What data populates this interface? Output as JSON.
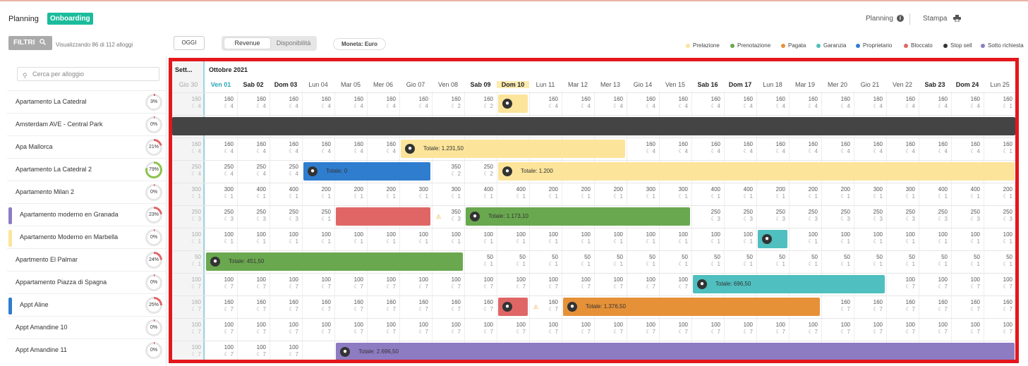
{
  "header": {
    "title": "Planning",
    "badge": "Onboarding",
    "planning_link": "Planning",
    "print_link": "Stampa"
  },
  "toolbar": {
    "filter_label": "FILTRI",
    "filter_summary": "Visualizzando 86 di 112 alloggi",
    "today_button": "OGGI",
    "view_revenue": "Revenue",
    "view_availability": "Disponibilità",
    "currency": "Moneta: Euro"
  },
  "legend": [
    {
      "label": "Prelazione",
      "color": "#fce49a"
    },
    {
      "label": "Prenotazione",
      "color": "#6aa84f"
    },
    {
      "label": "Pagata",
      "color": "#e69138"
    },
    {
      "label": "Garanzia",
      "color": "#4fbfbf"
    },
    {
      "label": "Proprietario",
      "color": "#2f7dcf"
    },
    {
      "label": "Bloccato",
      "color": "#e06666"
    },
    {
      "label": "Stop sell",
      "color": "#333333"
    },
    {
      "label": "Sotto richiesta",
      "color": "#8e7cc3"
    }
  ],
  "search": {
    "placeholder": "Cerca per alloggio"
  },
  "properties": [
    {
      "name": "Apartamento La Catedral",
      "pct": "3%",
      "ring": "#e06666",
      "val": 3,
      "tag": ""
    },
    {
      "name": "Amsterdam AVE - Central Park",
      "pct": "0%",
      "ring": "#e06666",
      "val": 0,
      "tag": ""
    },
    {
      "name": "Apa Mallorca",
      "pct": "21%",
      "ring": "#e06666",
      "val": 21,
      "tag": ""
    },
    {
      "name": "Apartamento La Catedral 2",
      "pct": "79%",
      "ring": "#8bc34a",
      "val": 79,
      "tag": ""
    },
    {
      "name": "Apartamento Milan 2",
      "pct": "0%",
      "ring": "#e06666",
      "val": 0,
      "tag": ""
    },
    {
      "name": "Apartamento moderno en Granada",
      "pct": "23%",
      "ring": "#e06666",
      "val": 23,
      "tag": "#8e7cc3"
    },
    {
      "name": "Apartamento Moderno en Marbella",
      "pct": "0%",
      "ring": "#e06666",
      "val": 0,
      "tag": "#fce49a"
    },
    {
      "name": "Apartmento El Palmar",
      "pct": "24%",
      "ring": "#e06666",
      "val": 24,
      "tag": ""
    },
    {
      "name": "Appartamento Piazza di Spagna",
      "pct": "0%",
      "ring": "#e06666",
      "val": 0,
      "tag": ""
    },
    {
      "name": "Appt Aline",
      "pct": "25%",
      "ring": "#e06666",
      "val": 25,
      "tag": "#2f7dcf"
    },
    {
      "name": "Appt Amandine 10",
      "pct": "0%",
      "ring": "#e06666",
      "val": 0,
      "tag": ""
    },
    {
      "name": "Appt Amandine 11",
      "pct": "0%",
      "ring": "#e06666",
      "val": 0,
      "tag": ""
    }
  ],
  "calendar": {
    "prev_month": "Sett...",
    "month": "Ottobre 2021",
    "days": [
      "Gio 30",
      "Ven 01",
      "Sab 02",
      "Dom 03",
      "Lun 04",
      "Mar 05",
      "Mer 06",
      "Gio 07",
      "Ven 08",
      "Sab 09",
      "Dom 10",
      "Lun 11",
      "Mar 12",
      "Mer 13",
      "Gio 14",
      "Ven 15",
      "Sab 16",
      "Dom 17",
      "Lun 18",
      "Mar 19",
      "Mer 20",
      "Gio 21",
      "Ven 22",
      "Sab 23",
      "Dom 24",
      "Lun 25"
    ],
    "weekend": [
      false,
      false,
      true,
      true,
      false,
      false,
      false,
      false,
      false,
      true,
      true,
      false,
      false,
      false,
      false,
      false,
      true,
      true,
      false,
      false,
      false,
      false,
      false,
      true,
      true,
      false
    ],
    "rows": [
      {
        "prices": [
          160,
          160,
          160,
          160,
          160,
          160,
          160,
          160,
          160,
          160,
          "",
          160,
          160,
          160,
          160,
          160,
          160,
          160,
          160,
          160,
          160,
          160,
          160,
          160,
          160,
          160
        ],
        "mins": [
          4,
          4,
          4,
          4,
          4,
          4,
          4,
          4,
          2,
          2,
          "",
          4,
          4,
          4,
          4,
          4,
          4,
          4,
          4,
          4,
          4,
          4,
          4,
          4,
          4,
          1
        ]
      },
      {
        "prices": [],
        "mins": []
      },
      {
        "prices": [
          160,
          160,
          160,
          160,
          160,
          160,
          160,
          "",
          "",
          "",
          "",
          "",
          "",
          "",
          160,
          160,
          160,
          160,
          160,
          160,
          160,
          160,
          160,
          160,
          160,
          160
        ],
        "mins": [
          4,
          4,
          4,
          4,
          4,
          4,
          4,
          "",
          "",
          "",
          "",
          "",
          "",
          "",
          4,
          4,
          4,
          4,
          4,
          4,
          4,
          4,
          4,
          4,
          4,
          1
        ]
      },
      {
        "prices": [
          250,
          250,
          250,
          250,
          "",
          "",
          "",
          "",
          350,
          250,
          "",
          "",
          "",
          "",
          "",
          "",
          "",
          "",
          "",
          "",
          "",
          "",
          "",
          "",
          "",
          ""
        ],
        "mins": [
          4,
          4,
          4,
          4,
          "",
          "",
          "",
          "",
          2,
          2,
          "",
          "",
          "",
          "",
          "",
          "",
          "",
          "",
          "",
          "",
          "",
          "",
          "",
          "",
          "",
          ""
        ]
      },
      {
        "prices": [
          300,
          300,
          400,
          400,
          200,
          200,
          200,
          300,
          300,
          400,
          400,
          200,
          200,
          200,
          300,
          300,
          400,
          400,
          200,
          200,
          200,
          300,
          300,
          400,
          400,
          200
        ],
        "mins": [
          1,
          1,
          1,
          1,
          1,
          1,
          1,
          1,
          1,
          1,
          1,
          1,
          1,
          1,
          1,
          1,
          1,
          1,
          1,
          1,
          1,
          1,
          1,
          1,
          1,
          1
        ]
      },
      {
        "prices": [
          250,
          250,
          250,
          250,
          250,
          "",
          "",
          "",
          350,
          "",
          "",
          "",
          "",
          "",
          "",
          "",
          250,
          250,
          250,
          250,
          250,
          250,
          250,
          250,
          250,
          250
        ],
        "mins": [
          3,
          3,
          3,
          3,
          1,
          "",
          "",
          "",
          3,
          "",
          "",
          "",
          "",
          "",
          "",
          "",
          3,
          3,
          3,
          3,
          3,
          3,
          3,
          3,
          3,
          3
        ]
      },
      {
        "prices": [
          100,
          100,
          100,
          100,
          100,
          100,
          100,
          100,
          100,
          100,
          100,
          100,
          100,
          100,
          100,
          100,
          100,
          100,
          "",
          100,
          100,
          100,
          100,
          100,
          100,
          100
        ],
        "mins": [
          1,
          1,
          1,
          1,
          1,
          1,
          1,
          1,
          1,
          1,
          1,
          1,
          1,
          1,
          1,
          1,
          1,
          1,
          "",
          1,
          1,
          1,
          1,
          1,
          1,
          1
        ]
      },
      {
        "prices": [
          50,
          "",
          "",
          "",
          "",
          "",
          "",
          "",
          "",
          50,
          50,
          50,
          50,
          50,
          50,
          50,
          50,
          50,
          50,
          50,
          50,
          50,
          50,
          50,
          50,
          50
        ],
        "mins": [
          1,
          "",
          "",
          "",
          "",
          "",
          "",
          "",
          "",
          1,
          1,
          1,
          1,
          1,
          1,
          1,
          1,
          1,
          1,
          1,
          1,
          1,
          1,
          1,
          1,
          1
        ]
      },
      {
        "prices": [
          100,
          100,
          100,
          100,
          100,
          100,
          100,
          100,
          100,
          100,
          100,
          100,
          100,
          100,
          100,
          100,
          "",
          "",
          "",
          "",
          "",
          "",
          100,
          100,
          100,
          100
        ],
        "mins": [
          7,
          7,
          7,
          7,
          7,
          7,
          7,
          7,
          7,
          7,
          7,
          7,
          7,
          7,
          7,
          7,
          "",
          "",
          "",
          "",
          "",
          "",
          7,
          7,
          7,
          7
        ]
      },
      {
        "prices": [
          160,
          160,
          160,
          160,
          160,
          160,
          160,
          160,
          160,
          160,
          "",
          160,
          "",
          "",
          "",
          "",
          "",
          "",
          "",
          "",
          160,
          160,
          160,
          160,
          160,
          160
        ],
        "mins": [
          7,
          7,
          7,
          7,
          7,
          7,
          7,
          7,
          7,
          7,
          "",
          7,
          "",
          "",
          "",
          "",
          "",
          "",
          "",
          "",
          7,
          7,
          7,
          7,
          7,
          7
        ]
      },
      {
        "prices": [
          100,
          100,
          100,
          100,
          100,
          100,
          100,
          100,
          100,
          100,
          100,
          100,
          100,
          100,
          100,
          100,
          100,
          100,
          100,
          100,
          100,
          100,
          100,
          100,
          100,
          100
        ],
        "mins": [
          7,
          7,
          7,
          7,
          7,
          7,
          7,
          7,
          7,
          7,
          7,
          7,
          7,
          7,
          7,
          7,
          7,
          7,
          7,
          7,
          7,
          7,
          7,
          7,
          7,
          7
        ]
      },
      {
        "prices": [
          100,
          100,
          100,
          100,
          "",
          "",
          "",
          "",
          "",
          "",
          "",
          "",
          "",
          "",
          "",
          "",
          "",
          "",
          "",
          "",
          "",
          "",
          "",
          "",
          "",
          ""
        ],
        "mins": [
          7,
          7,
          7,
          7,
          "",
          "",
          "",
          "",
          "",
          "",
          "",
          "",
          "",
          "",
          "",
          "",
          "",
          "",
          "",
          "",
          "",
          "",
          "",
          "",
          "",
          ""
        ]
      }
    ],
    "bands": [
      {
        "row": 0,
        "start": 10,
        "span": 1,
        "color": "#fce49a",
        "label": ""
      },
      {
        "row": 1,
        "start": 0,
        "span": 26,
        "color": "#444444",
        "label": ""
      },
      {
        "row": 2,
        "start": 7,
        "span": 7,
        "color": "#fce49a",
        "label": "Totale: 1.231,50"
      },
      {
        "row": 3,
        "start": 4,
        "span": 4,
        "color": "#2f7dcf",
        "label": "Totale: 0"
      },
      {
        "row": 3,
        "start": 10,
        "span": 16,
        "color": "#fce49a",
        "label": "Totale: 1.200"
      },
      {
        "row": 5,
        "start": 5,
        "span": 3,
        "color": "#e06666",
        "label": ""
      },
      {
        "row": 5,
        "start": 9,
        "span": 7,
        "color": "#6aa84f",
        "label": "Totale: 1.173,10"
      },
      {
        "row": 6,
        "start": 18,
        "span": 1,
        "color": "#4fbfbf",
        "label": ""
      },
      {
        "row": 7,
        "start": 1,
        "span": 8,
        "color": "#6aa84f",
        "label": "Totale: 451,50"
      },
      {
        "row": 8,
        "start": 16,
        "span": 6,
        "color": "#4fbfbf",
        "label": "Totale: 696,50"
      },
      {
        "row": 9,
        "start": 10,
        "span": 1,
        "color": "#e06666",
        "label": ""
      },
      {
        "row": 9,
        "start": 12,
        "span": 8,
        "color": "#e69138",
        "label": "Totale: 1.376,50"
      },
      {
        "row": 11,
        "start": 5,
        "span": 21,
        "color": "#8e7cc3",
        "label": "Totale: 2.696,50"
      }
    ],
    "warnings": [
      {
        "row": 5,
        "col": 8
      },
      {
        "row": 9,
        "col": 11
      }
    ]
  }
}
